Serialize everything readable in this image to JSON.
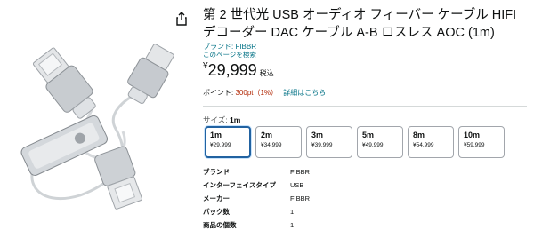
{
  "product": {
    "title": "第 2 世代光 USB オーディオ フィーバー ケーブル HIFI デコーダー DAC ケーブル A-B ロスレス AOC (1m)",
    "brand_link": "ブランド: FIBBR",
    "search_page_link": "このページを検索",
    "price_symbol": "¥",
    "price": "29,999",
    "tax_label": "税込",
    "points_label": "ポイント:",
    "points_value": "300pt（1%）",
    "points_detail_link": "詳細はこちら"
  },
  "size": {
    "label": "サイズ:",
    "selected": "1m",
    "options": [
      {
        "name": "1m",
        "price": "¥29,999"
      },
      {
        "name": "2m",
        "price": "¥34,999"
      },
      {
        "name": "3m",
        "price": "¥39,999"
      },
      {
        "name": "5m",
        "price": "¥49,999"
      },
      {
        "name": "8m",
        "price": "¥54,999"
      },
      {
        "name": "10m",
        "price": "¥59,999"
      }
    ]
  },
  "specs": [
    {
      "key": "ブランド",
      "value": "FIBBR"
    },
    {
      "key": "インターフェイスタイプ",
      "value": "USB"
    },
    {
      "key": "メーカー",
      "value": "FIBBR"
    },
    {
      "key": "パック数",
      "value": "1"
    },
    {
      "key": "商品の個数",
      "value": "1"
    }
  ],
  "icons": {
    "share": "share-icon"
  },
  "colors": {
    "link": "#007185",
    "points": "#b12704",
    "selected_border": "#2162a1"
  }
}
